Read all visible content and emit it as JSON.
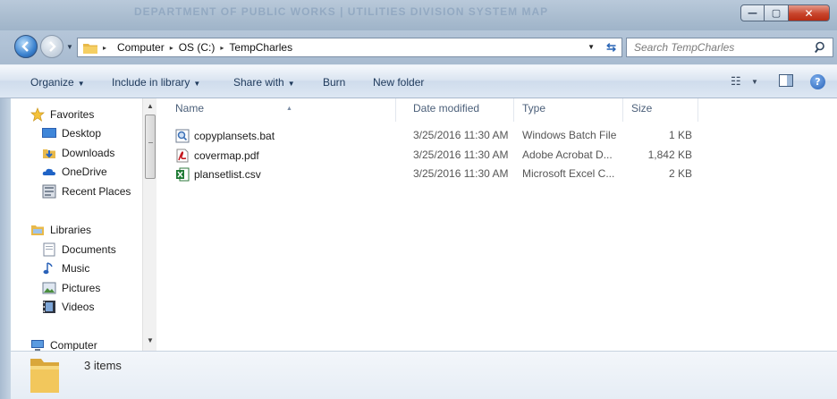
{
  "window": {
    "background_title": "DEPARTMENT OF PUBLIC WORKS  |  UTILITIES DIVISION SYSTEM MAP",
    "controls": {
      "minimize": "—",
      "maximize": "▢",
      "close": "✕"
    }
  },
  "address_bar": {
    "breadcrumbs": [
      "Computer",
      "OS (C:)",
      "TempCharles"
    ],
    "separator": "▸"
  },
  "search": {
    "placeholder": "Search TempCharles"
  },
  "toolbar": {
    "organize": "Organize",
    "include_in_library": "Include in library",
    "share_with": "Share with",
    "burn": "Burn",
    "new_folder": "New folder"
  },
  "nav_pane": {
    "favorites": {
      "label": "Favorites",
      "items": [
        "Desktop",
        "Downloads",
        "OneDrive",
        "Recent Places"
      ]
    },
    "libraries": {
      "label": "Libraries",
      "items": [
        "Documents",
        "Music",
        "Pictures",
        "Videos"
      ]
    },
    "computer": {
      "label": "Computer"
    }
  },
  "file_list": {
    "columns": {
      "name": "Name",
      "date_modified": "Date modified",
      "type": "Type",
      "size": "Size"
    },
    "rows": [
      {
        "name": "copyplansets.bat",
        "date": "3/25/2016 11:30 AM",
        "type": "Windows Batch File",
        "size": "1 KB",
        "icon": "batch-file-icon"
      },
      {
        "name": "covermap.pdf",
        "date": "3/25/2016 11:30 AM",
        "type": "Adobe Acrobat D...",
        "size": "1,842 KB",
        "icon": "pdf-file-icon"
      },
      {
        "name": "plansetlist.csv",
        "date": "3/25/2016 11:30 AM",
        "type": "Microsoft Excel C...",
        "size": "2 KB",
        "icon": "excel-file-icon"
      }
    ]
  },
  "details": {
    "item_count": "3 items"
  },
  "colors": {
    "accent": "#2c67b6",
    "toolbar_text": "#1e395b",
    "header_text": "#4c607a"
  }
}
